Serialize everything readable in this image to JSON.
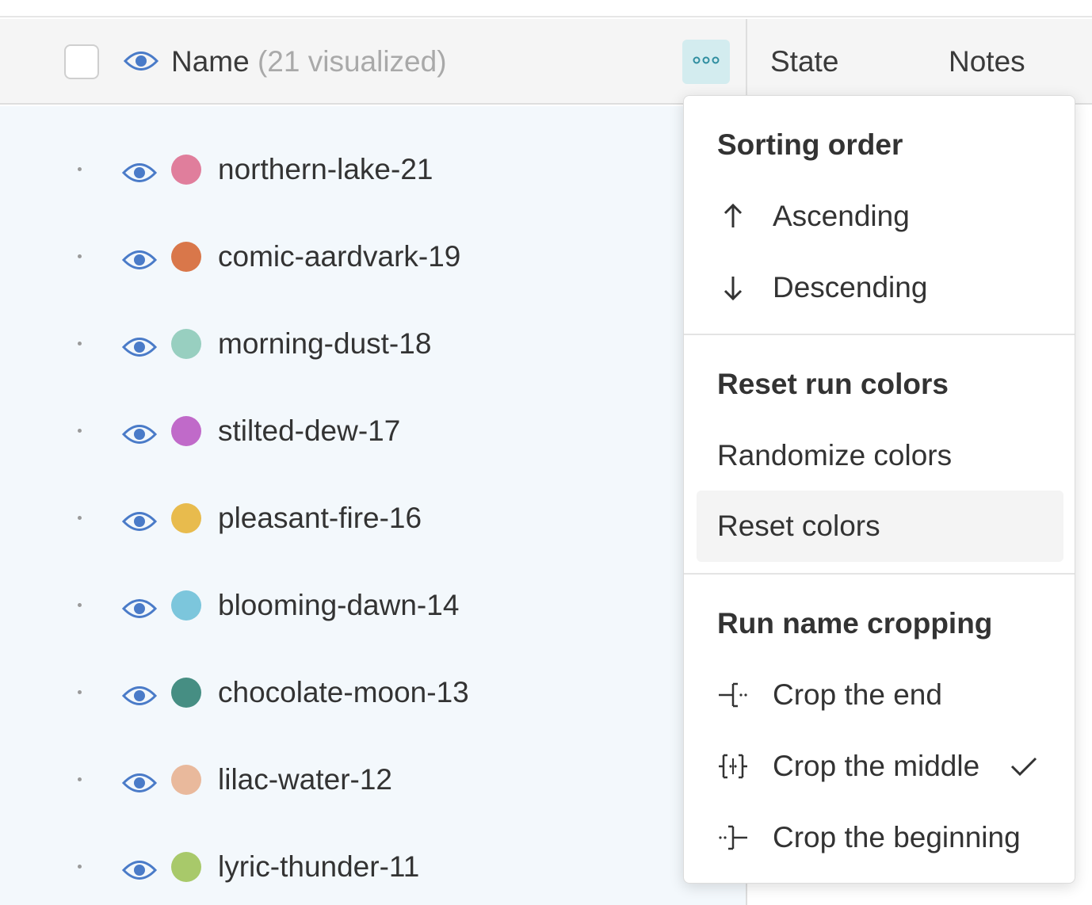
{
  "header": {
    "name_label": "Name",
    "name_count": "(21 visualized)",
    "state_label": "State",
    "notes_label": "Notes"
  },
  "runs": [
    {
      "name": "northern-lake-21",
      "color": "#e07e9c"
    },
    {
      "name": "comic-aardvark-19",
      "color": "#d9774a"
    },
    {
      "name": "morning-dust-18",
      "color": "#98cfc0"
    },
    {
      "name": "stilted-dew-17",
      "color": "#c06ac9"
    },
    {
      "name": "pleasant-fire-16",
      "color": "#e8bb4d"
    },
    {
      "name": "blooming-dawn-14",
      "color": "#7cc6dc"
    },
    {
      "name": "chocolate-moon-13",
      "color": "#468e83"
    },
    {
      "name": "lilac-water-12",
      "color": "#e9b99c"
    },
    {
      "name": "lyric-thunder-11",
      "color": "#a8c96a"
    }
  ],
  "menu": {
    "sorting_heading": "Sorting order",
    "ascending": "Ascending",
    "descending": "Descending",
    "reset_heading": "Reset run colors",
    "randomize": "Randomize colors",
    "reset": "Reset colors",
    "cropping_heading": "Run name cropping",
    "crop_end": "Crop the end",
    "crop_middle": "Crop the middle",
    "crop_beginning": "Crop the beginning",
    "selected_crop": "Crop the middle"
  },
  "icons": {
    "visibility": "eye-icon",
    "more": "more-horizontal-icon",
    "ascending": "arrow-up-icon",
    "descending": "arrow-down-icon",
    "crop_end": "crop-end-icon",
    "crop_middle": "crop-middle-icon",
    "crop_beginning": "crop-beginning-icon",
    "selected": "checkmark-icon"
  },
  "colors": {
    "accent": "#4a7bc8",
    "header_bg": "#f5f5f5",
    "rows_bg": "#f3f8fc",
    "more_button_bg": "#d3ecef"
  }
}
